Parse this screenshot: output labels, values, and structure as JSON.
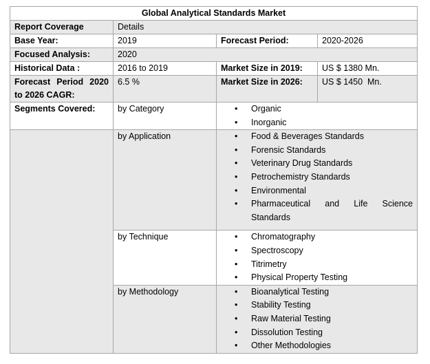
{
  "title": "Global Analytical Standards Market",
  "report_coverage": {
    "label": "Report Coverage",
    "value": "Details"
  },
  "base_year": {
    "label": "Base Year:",
    "value": "2019"
  },
  "forecast_period": {
    "label": "Forecast Period:",
    "value": "2020-2026"
  },
  "focused_analysis": {
    "label": "Focused Analysis:",
    "value": "2020"
  },
  "historical_data": {
    "label": "Historical Data :",
    "value": "2016 to 2019"
  },
  "market_size_2019": {
    "label": "Market Size in 2019:",
    "value": "US $ 1380 Mn."
  },
  "cagr": {
    "label_line1": "Forecast Period 2020",
    "label_line2": "to 2026 CAGR:",
    "value": "6.5 %"
  },
  "market_size_2026": {
    "label": "Market Size in 2026:",
    "value": "US $ 1450  Mn."
  },
  "segments_label": "Segments Covered:",
  "bullet_char": "•",
  "segments": [
    {
      "name": "by Category",
      "items": [
        "Organic",
        "Inorganic"
      ]
    },
    {
      "name": "by Application",
      "items": [
        "Food & Beverages Standards",
        "Forensic Standards",
        "Veterinary Drug Standards",
        "Petrochemistry Standards",
        "Environmental",
        "Pharmaceutical and Life Science",
        "Standards"
      ]
    },
    {
      "name": "by Technique",
      "items": [
        "Chromatography",
        "Spectroscopy",
        "Titrimetry",
        "Physical Property Testing"
      ]
    },
    {
      "name": "by Methodology",
      "items": [
        "Bioanalytical Testing",
        "Stability Testing",
        "Raw Material Testing",
        "Dissolution Testing",
        "Other Methodologies"
      ]
    }
  ]
}
